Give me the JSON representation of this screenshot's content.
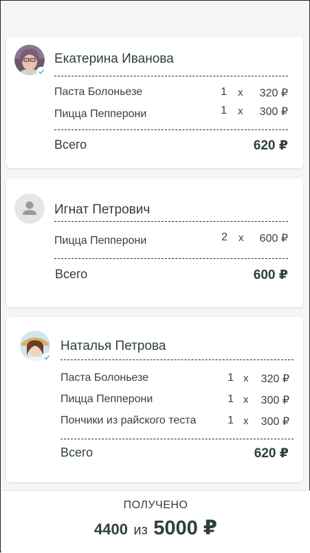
{
  "orders": [
    {
      "name": "Екатерина Иванова",
      "avatar": "user-photo-woman-glasses",
      "verified": true,
      "items": [
        {
          "name": "Паста Болоньезе",
          "qty": "1",
          "x": "x",
          "price": "320 ₽"
        },
        {
          "name": "Пицца Пепперони",
          "qty": "1",
          "x": "x",
          "price": "300 ₽"
        }
      ],
      "total_label": "Всего",
      "total": "620 ₽"
    },
    {
      "name": "Игнат Петрович",
      "avatar": "user-placeholder-icon",
      "verified": false,
      "items": [
        {
          "name": "Пицца Пепперони",
          "qty": "2",
          "x": "x",
          "price": "600 ₽"
        }
      ],
      "total_label": "Всего",
      "total": "600 ₽"
    },
    {
      "name": "Наталья Петрова",
      "avatar": "user-photo-woman-hat",
      "verified": true,
      "items": [
        {
          "name": "Паста Болоньезе",
          "qty": "1",
          "x": "x",
          "price": "320 ₽"
        },
        {
          "name": "Пицца Пепперони",
          "qty": "1",
          "x": "x",
          "price": "300 ₽"
        },
        {
          "name": "Пончики из райского теста",
          "qty": "1",
          "x": "x",
          "price": "300 ₽"
        }
      ],
      "total_label": "Всего",
      "total": "620 ₽"
    }
  ],
  "footer": {
    "label": "ПОЛУЧЕНО",
    "received": "4400",
    "of": "из",
    "total": "5000 ₽"
  },
  "colors": {
    "text": "#2f3e3e",
    "check": "#3fc0b8",
    "placeholder_bg": "#e6e6e6",
    "placeholder_fg": "#9a9a9a"
  }
}
